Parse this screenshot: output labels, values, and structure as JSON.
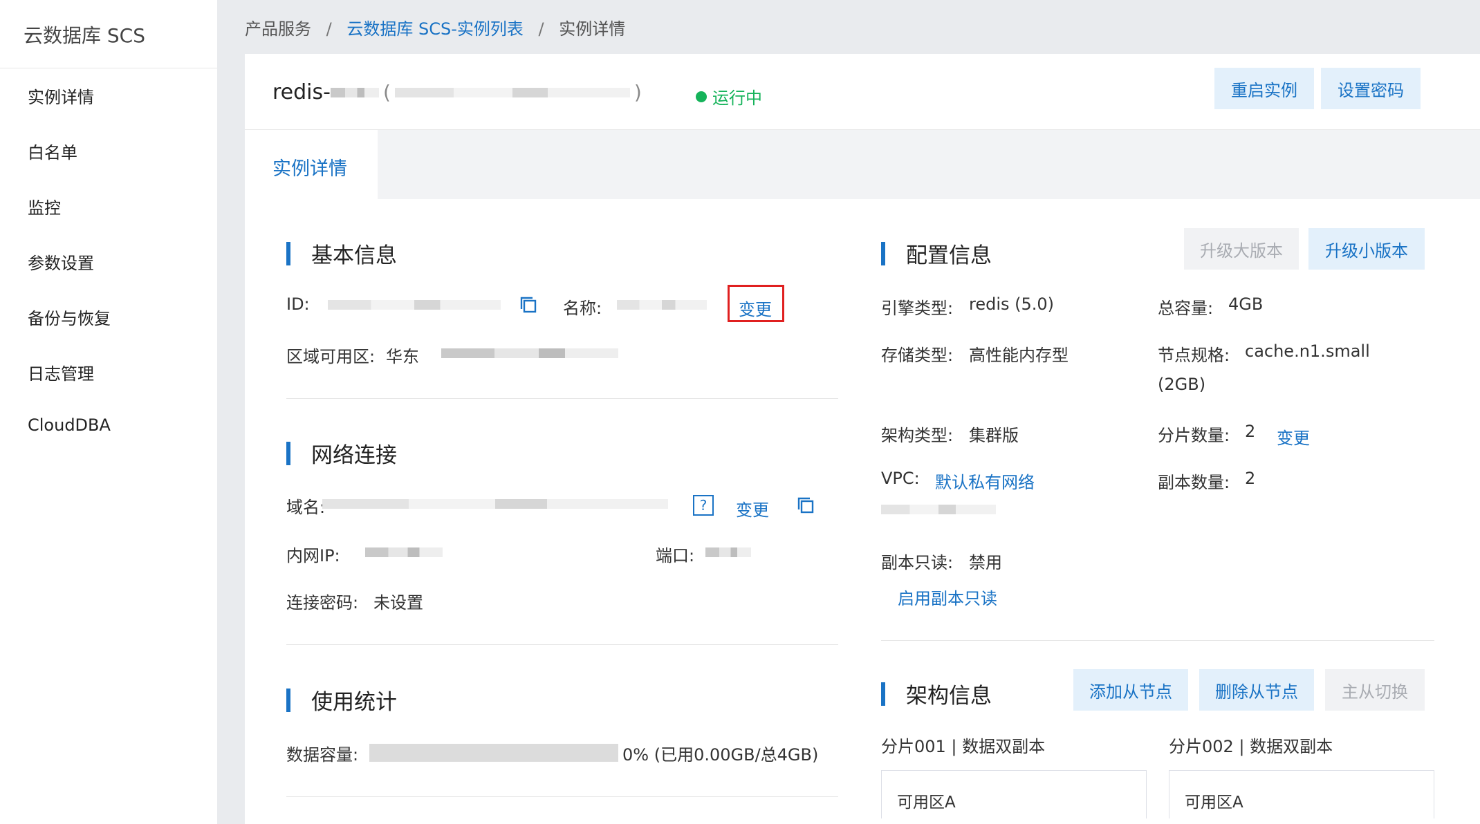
{
  "sidebar": {
    "title": "云数据库 SCS",
    "items": [
      "实例详情",
      "白名单",
      "监控",
      "参数设置",
      "备份与恢复",
      "日志管理",
      "CloudDBA"
    ]
  },
  "breadcrumb": {
    "root": "产品服务",
    "sep": "/",
    "list": "云数据库 SCS-实例列表",
    "current": "实例详情"
  },
  "header": {
    "name_prefix": "redis-",
    "open_paren": "(",
    "close_paren": ")",
    "status": "运行中",
    "restart_label": "重启实例",
    "password_label": "设置密码"
  },
  "tabs": {
    "active": "实例详情"
  },
  "basic": {
    "title": "基本信息",
    "id_label": "ID:",
    "name_label": "名称:",
    "change_label": "变更",
    "zone_label": "区域可用区:",
    "zone_value": "华东"
  },
  "network": {
    "title": "网络连接",
    "domain_label": "域名:",
    "help": "?",
    "change_label": "变更",
    "ip_label": "内网IP:",
    "port_label": "端口:",
    "password_label": "连接密码:",
    "password_value": "未设置"
  },
  "usage": {
    "title": "使用统计",
    "capacity_label": "数据容量:",
    "capacity_text": "0% (已用0.00GB/总4GB)",
    "percent": 0
  },
  "config": {
    "title": "配置信息",
    "major_upgrade": "升级大版本",
    "minor_upgrade": "升级小版本",
    "engine_label": "引擎类型:",
    "engine_value": "redis (5.0)",
    "total_label": "总容量:",
    "total_value": "4GB",
    "storage_label": "存储类型:",
    "storage_value": "高性能内存型",
    "node_label": "节点规格:",
    "node_value": "cache.n1.small",
    "node_value2": "(2GB)",
    "arch_label": "架构类型:",
    "arch_value": "集群版",
    "shards_label": "分片数量:",
    "shards_value": "2",
    "shards_change": "变更",
    "vpc_label": "VPC:",
    "vpc_value": "默认私有网络",
    "replicas_label": "副本数量:",
    "replicas_value": "2",
    "readonly_label": "副本只读:",
    "readonly_value": "禁用",
    "enable_readonly": "启用副本只读"
  },
  "architecture": {
    "title": "架构信息",
    "add_slave": "添加从节点",
    "del_slave": "删除从节点",
    "switch": "主从切换",
    "shard1": "分片001 | 数据双副本",
    "shard2": "分片002 | 数据双副本",
    "zone1": "可用区A",
    "zone2": "可用区A"
  },
  "colors": {
    "accent": "#1a73c5",
    "status": "#15b35a",
    "highlight": "#e02020"
  }
}
